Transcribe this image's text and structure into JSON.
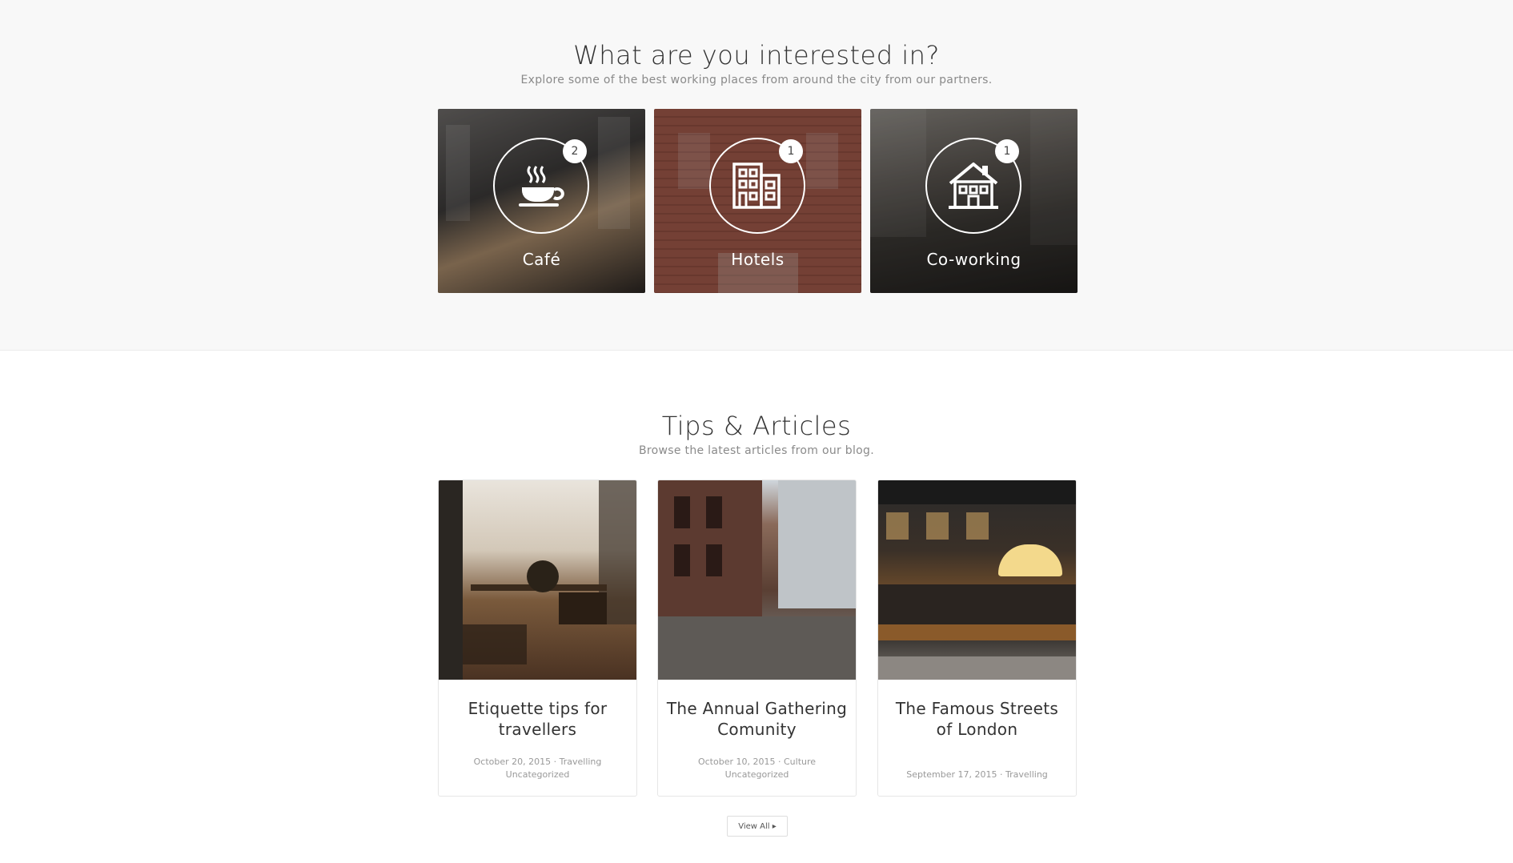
{
  "interests": {
    "title": "What are you interested in?",
    "subtitle": "Explore some of the best working places from around the city from our partners.",
    "categories": [
      {
        "label": "Café",
        "count": "2",
        "icon": "coffee-cup-icon"
      },
      {
        "label": "Hotels",
        "count": "1",
        "icon": "hotel-building-icon"
      },
      {
        "label": "Co-working",
        "count": "1",
        "icon": "house-icon"
      }
    ]
  },
  "tips": {
    "title": "Tips & Articles",
    "subtitle": "Browse the latest articles from our blog.",
    "articles": [
      {
        "title": "Etiquette tips for travellers",
        "date": "October 20, 2015",
        "categories": "Travelling",
        "extra": "Uncategorized"
      },
      {
        "title": "The Annual Gathering Comunity",
        "date": "October 10, 2015",
        "categories": "Culture",
        "extra": "Uncategorized"
      },
      {
        "title": "The Famous Streets of London",
        "date": "September 17, 2015",
        "categories": "Travelling",
        "extra": ""
      }
    ],
    "view_all": "View All ▸"
  },
  "colors": {
    "section_bg": "#f8f8f8",
    "text": "#333333",
    "muted": "#8a8a8a"
  }
}
